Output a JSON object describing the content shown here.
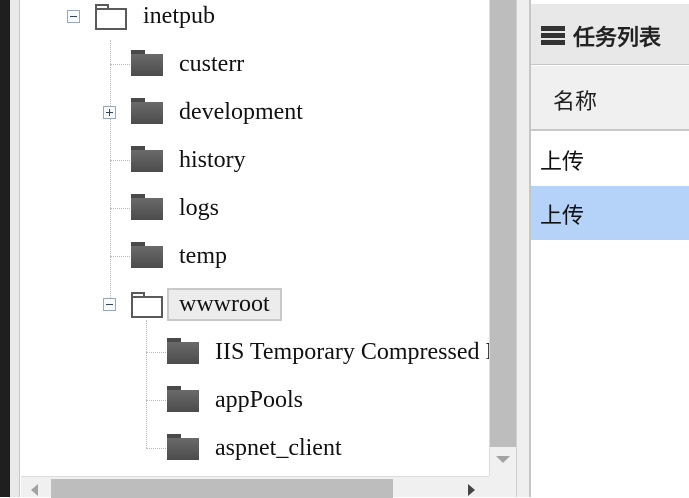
{
  "tree": {
    "root": {
      "label": "inetpub",
      "expanded": true
    },
    "children": [
      {
        "label": "custerr"
      },
      {
        "label": "development",
        "collapsed": true
      },
      {
        "label": "history"
      },
      {
        "label": "logs"
      },
      {
        "label": "temp"
      },
      {
        "label": "wwwroot",
        "expanded": true,
        "selected": true
      }
    ],
    "wwwroot_children": [
      {
        "label": "IIS Temporary Compressed Files"
      },
      {
        "label": "appPools"
      },
      {
        "label": "aspnet_client"
      }
    ]
  },
  "task_panel": {
    "title": "任务列表",
    "icon": "list-icon",
    "column_header": "名称",
    "rows": [
      {
        "label": "上传",
        "selected": false
      },
      {
        "label": "上传",
        "selected": true
      }
    ]
  },
  "colors": {
    "selected_row": "#b5d3f8",
    "header_bg": "#e8e8e8",
    "folder": "#555555"
  }
}
